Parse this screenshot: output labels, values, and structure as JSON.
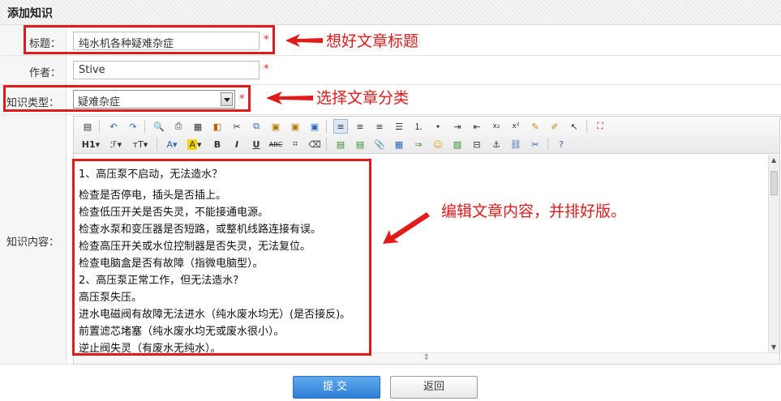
{
  "header": {
    "title": "添加知识"
  },
  "form": {
    "title": {
      "label": "标题：",
      "value": "纯水机各种疑难杂症",
      "required": "*"
    },
    "author": {
      "label": "作者：",
      "value": "Stive",
      "required": "*"
    },
    "category": {
      "label": "知识类型：",
      "value": "疑难杂症",
      "required": "*"
    },
    "content": {
      "label": "知识内容：",
      "lines": [
        "1、高压泵不启动，无法造水？",
        "检查是否停电，插头是否插上。",
        "检查低压开关是否失灵，不能接通电源。",
        "检查水泵和变压器是否短路，或整机线路连接有误。",
        "检查高压开关或水位控制器是否失灵，无法复位。",
        "检查电脑盒是否有故障（指微电脑型）。",
        "2、高压泵正常工作，但无法造水？",
        "高压泵失压。",
        "进水电磁阀有故障无法进水（纯水废水均无）(是否接反)。",
        "前置滤芯堵塞（纯水废水均无或废水很小）。",
        "逆止阀失灵（有废水无纯水）。"
      ]
    }
  },
  "toolbar": {
    "row1": [
      "source-icon",
      "undo-icon",
      "redo-icon",
      "preview-icon",
      "print-icon",
      "template-icon",
      "insert-code-icon",
      "cut-icon",
      "copy-icon",
      "paste-icon",
      "paste-text-icon",
      "paste-word-icon",
      "align-left-icon",
      "align-center-icon",
      "align-right-icon",
      "justify-icon",
      "ordered-list-icon",
      "unordered-list-icon",
      "indent-icon",
      "outdent-icon",
      "subscript-icon",
      "superscript-icon",
      "clear-format-icon",
      "select-all-icon",
      "cursor-icon",
      "fullscreen-icon"
    ],
    "row2_labels": {
      "heading": "H1",
      "font": "ℱ",
      "size": "тT",
      "color": "A",
      "bg": "A",
      "bold": "B",
      "italic": "I",
      "underline": "U",
      "strike": "ABC"
    }
  },
  "annotations": {
    "title_hint": "想好文章标题",
    "category_hint": "选择文章分类",
    "content_hint": "编辑文章内容，并排好版。"
  },
  "buttons": {
    "submit": "提交",
    "back": "返回"
  },
  "colors": {
    "accent_red": "#e01b1b",
    "submit_blue": "#3a8ae0"
  }
}
